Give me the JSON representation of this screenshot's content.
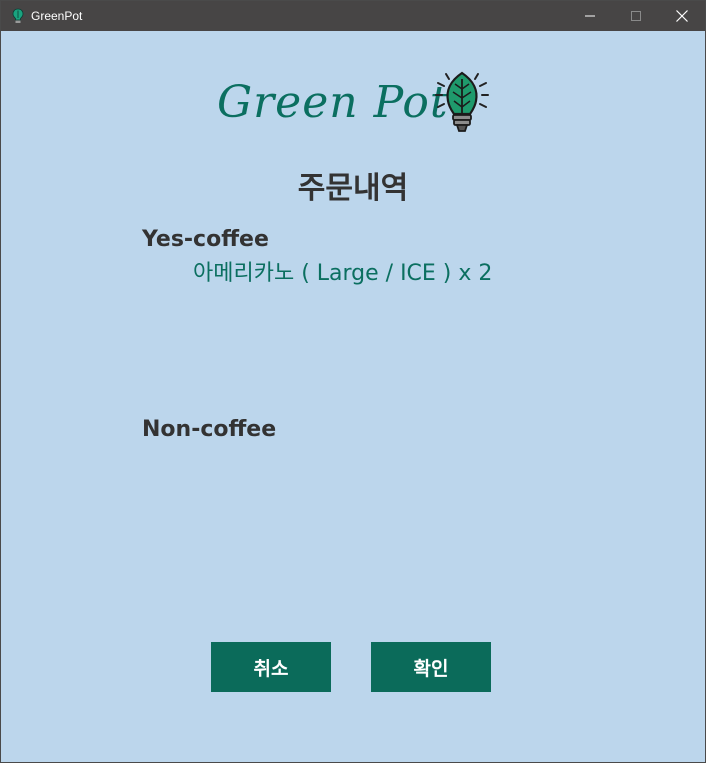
{
  "window": {
    "title": "GreenPot",
    "controls": {
      "minimize_icon": "minimize-icon",
      "maximize_icon": "maximize-icon",
      "close_icon": "close-icon"
    }
  },
  "logo": {
    "text": "Green Pot",
    "icon": "lightbulb-leaf-icon"
  },
  "page": {
    "title": "주문내역"
  },
  "sections": {
    "yes_coffee": {
      "label": "Yes-coffee",
      "items": [
        "아메리카노 ( Large / ICE ) x 2"
      ]
    },
    "non_coffee": {
      "label": "Non-coffee",
      "items": []
    }
  },
  "buttons": {
    "cancel": "취소",
    "confirm": "확인"
  },
  "colors": {
    "background": "#bcd6ec",
    "brand_green": "#0b6f60",
    "button_green": "#0b6b5a",
    "titlebar": "#474545",
    "text_dark": "#333333"
  }
}
